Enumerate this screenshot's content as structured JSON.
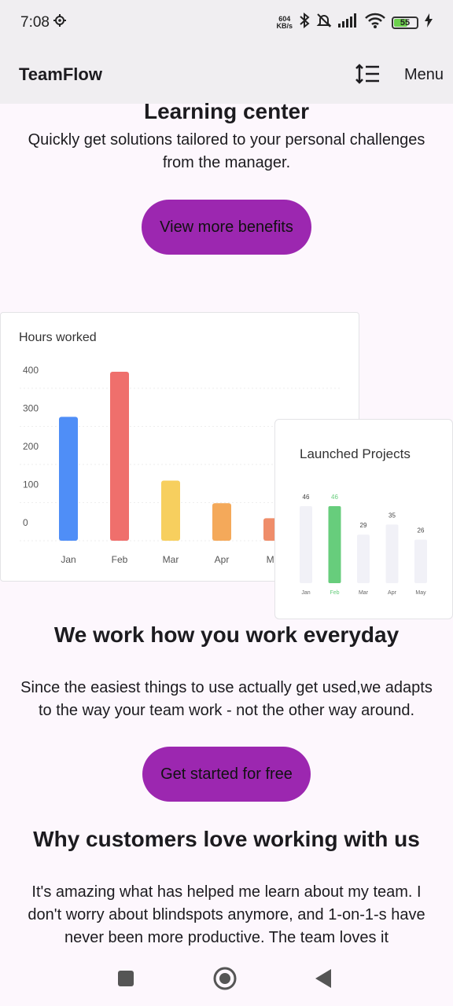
{
  "status": {
    "time": "7:08",
    "speed_value": "604",
    "speed_unit": "KB/s",
    "battery": "55"
  },
  "app_bar": {
    "title": "TeamFlow",
    "menu_label": "Menu"
  },
  "learning": {
    "title": "Learning center",
    "line1": "Quickly get solutions tailored to your personal challenges",
    "line2": "from the manager.",
    "button": "View more benefits"
  },
  "charts": {
    "hours": {
      "title": "Hours worked"
    },
    "launched": {
      "title": "Launched Projects"
    }
  },
  "chart_data": [
    {
      "type": "bar",
      "title": "Hours worked",
      "categories": [
        "Jan",
        "Feb",
        "Mar",
        "Apr",
        "May"
      ],
      "tick_labels": [
        "Jan",
        "Feb",
        "Mar",
        "Apr",
        "Ma"
      ],
      "values": [
        330,
        450,
        160,
        100,
        60
      ],
      "colors": [
        "#4f8ef7",
        "#ef6f6c",
        "#f7cf5e",
        "#f4a95a",
        "#ef8d6a"
      ],
      "yticks": [
        "400",
        "300",
        "200",
        "100",
        "0"
      ],
      "grid": true
    },
    {
      "type": "bar",
      "title": "Launched Projects",
      "categories": [
        "Jan",
        "Feb",
        "Mar",
        "Apr",
        "May"
      ],
      "values": [
        46,
        46,
        29,
        35,
        26
      ],
      "value_labels": [
        "46",
        "46",
        "29",
        "35",
        "26"
      ],
      "highlight": "Feb",
      "colors": {
        "default": "#f1f1f7",
        "highlight": "#67cd7c"
      },
      "grid": false
    }
  ],
  "work": {
    "title": "We work how you work everyday",
    "line1": "Since the easiest things to use actually get used,we adapts",
    "line2": "to the way your team work - not the other way around.",
    "button": "Get started for free"
  },
  "customers": {
    "title": "Why customers love working with us",
    "line1": "It's amazing what has helped me learn about my team. I",
    "line2": "don't worry about blindspots anymore, and 1-on-1-s have",
    "line3": "never been more productive. The team loves it"
  }
}
